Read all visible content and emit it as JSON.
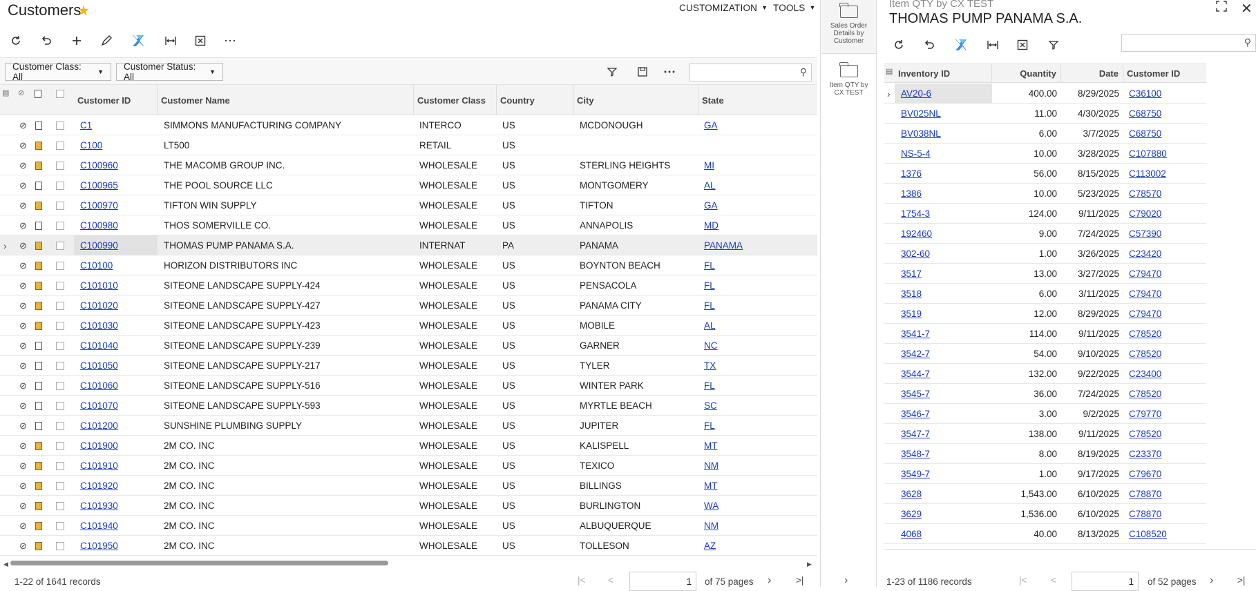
{
  "page": {
    "title": "Customers"
  },
  "menu": {
    "customization": "CUSTOMIZATION",
    "tools": "TOOLS"
  },
  "toolbar_icons": [
    "refresh-icon",
    "undo-icon",
    "add-icon",
    "edit-icon",
    "puzzle-icon",
    "fit-width-icon",
    "export-excel-icon",
    "more-icon"
  ],
  "filters": {
    "customer_class": "Customer Class: All",
    "customer_status": "Customer Status: All"
  },
  "grid": {
    "columns": [
      "Customer ID",
      "Customer Name",
      "Customer Class",
      "Country",
      "City",
      "State"
    ],
    "rows": [
      {
        "id": "C1",
        "name": "SIMMONS MANUFACTURING COMPANY",
        "cls": "INTERCO",
        "country": "US",
        "city": "MCDONOUGH",
        "state": "GA",
        "note": false
      },
      {
        "id": "C100",
        "name": "LT500",
        "cls": "RETAIL",
        "country": "US",
        "city": "",
        "state": "",
        "note": true
      },
      {
        "id": "C100960",
        "name": "THE MACOMB GROUP INC.",
        "cls": "WHOLESALE",
        "country": "US",
        "city": "STERLING HEIGHTS",
        "state": "MI",
        "note": true
      },
      {
        "id": "C100965",
        "name": "THE POOL SOURCE LLC",
        "cls": "WHOLESALE",
        "country": "US",
        "city": "MONTGOMERY",
        "state": "AL",
        "note": false
      },
      {
        "id": "C100970",
        "name": "TIFTON WIN SUPPLY",
        "cls": "WHOLESALE",
        "country": "US",
        "city": "TIFTON",
        "state": "GA",
        "note": true
      },
      {
        "id": "C100980",
        "name": "THOS SOMERVILLE CO.",
        "cls": "WHOLESALE",
        "country": "US",
        "city": "ANNAPOLIS",
        "state": "MD",
        "note": false
      },
      {
        "id": "C100990",
        "name": "THOMAS PUMP PANAMA S.A.",
        "cls": "INTERNAT",
        "country": "PA",
        "city": "PANAMA",
        "state": "PANAMA",
        "note": true,
        "selected": true
      },
      {
        "id": "C10100",
        "name": "HORIZON DISTRIBUTORS INC",
        "cls": "WHOLESALE",
        "country": "US",
        "city": "BOYNTON BEACH",
        "state": "FL",
        "note": true
      },
      {
        "id": "C101010",
        "name": "SITEONE LANDSCAPE SUPPLY-424",
        "cls": "WHOLESALE",
        "country": "US",
        "city": "PENSACOLA",
        "state": "FL",
        "note": true
      },
      {
        "id": "C101020",
        "name": "SITEONE LANDSCAPE SUPPLY-427",
        "cls": "WHOLESALE",
        "country": "US",
        "city": "PANAMA CITY",
        "state": "FL",
        "note": true
      },
      {
        "id": "C101030",
        "name": "SITEONE LANDSCAPE SUPPLY-423",
        "cls": "WHOLESALE",
        "country": "US",
        "city": "MOBILE",
        "state": "AL",
        "note": true
      },
      {
        "id": "C101040",
        "name": "SITEONE LANDSCAPE SUPPLY-239",
        "cls": "WHOLESALE",
        "country": "US",
        "city": "GARNER",
        "state": "NC",
        "note": false
      },
      {
        "id": "C101050",
        "name": "SITEONE LANDSCAPE SUPPLY-217",
        "cls": "WHOLESALE",
        "country": "US",
        "city": "TYLER",
        "state": "TX",
        "note": false
      },
      {
        "id": "C101060",
        "name": "SITEONE LANDSCAPE SUPPLY-516",
        "cls": "WHOLESALE",
        "country": "US",
        "city": "WINTER PARK",
        "state": "FL",
        "note": false
      },
      {
        "id": "C101070",
        "name": "SITEONE LANDSCAPE SUPPLY-593",
        "cls": "WHOLESALE",
        "country": "US",
        "city": "MYRTLE BEACH",
        "state": "SC",
        "note": false
      },
      {
        "id": "C101200",
        "name": "SUNSHINE PLUMBING SUPPLY",
        "cls": "WHOLESALE",
        "country": "US",
        "city": "JUPITER",
        "state": "FL",
        "note": false
      },
      {
        "id": "C101900",
        "name": "2M CO. INC",
        "cls": "WHOLESALE",
        "country": "US",
        "city": "KALISPELL",
        "state": "MT",
        "note": true
      },
      {
        "id": "C101910",
        "name": "2M CO. INC",
        "cls": "WHOLESALE",
        "country": "US",
        "city": "TEXICO",
        "state": "NM",
        "note": true
      },
      {
        "id": "C101920",
        "name": "2M CO. INC",
        "cls": "WHOLESALE",
        "country": "US",
        "city": "BILLINGS",
        "state": "MT",
        "note": true
      },
      {
        "id": "C101930",
        "name": "2M CO. INC",
        "cls": "WHOLESALE",
        "country": "US",
        "city": "BURLINGTON",
        "state": "WA",
        "note": true
      },
      {
        "id": "C101940",
        "name": "2M CO. INC",
        "cls": "WHOLESALE",
        "country": "US",
        "city": "ALBUQUERQUE",
        "state": "NM",
        "note": true
      },
      {
        "id": "C101950",
        "name": "2M CO. INC",
        "cls": "WHOLESALE",
        "country": "US",
        "city": "TOLLESON",
        "state": "AZ",
        "note": true
      }
    ]
  },
  "pager": {
    "records": "1-22 of 1641 records",
    "page": "1",
    "of_pages": "of 75 pages"
  },
  "side_tabs": {
    "tab1": "Sales Order Details by Customer",
    "tab2": "Item QTY by CX TEST"
  },
  "right_panel": {
    "subtitle": "Item QTY by CX TEST",
    "title": "THOMAS PUMP PANAMA S.A.",
    "columns": [
      "Inventory ID",
      "Quantity",
      "Date",
      "Customer ID"
    ],
    "rows": [
      {
        "inv": "AV20-6",
        "qty": "400.00",
        "date": "8/29/2025",
        "cust": "C36100",
        "selected": true
      },
      {
        "inv": "BV025NL",
        "qty": "11.00",
        "date": "4/30/2025",
        "cust": "C68750"
      },
      {
        "inv": "BV038NL",
        "qty": "6.00",
        "date": "3/7/2025",
        "cust": "C68750"
      },
      {
        "inv": "NS-5-4",
        "qty": "10.00",
        "date": "3/28/2025",
        "cust": "C107880"
      },
      {
        "inv": "1376",
        "qty": "56.00",
        "date": "8/15/2025",
        "cust": "C113002"
      },
      {
        "inv": "1386",
        "qty": "10.00",
        "date": "5/23/2025",
        "cust": "C78570"
      },
      {
        "inv": "1754-3",
        "qty": "124.00",
        "date": "9/11/2025",
        "cust": "C79020"
      },
      {
        "inv": "192460",
        "qty": "9.00",
        "date": "7/24/2025",
        "cust": "C57390"
      },
      {
        "inv": "302-60",
        "qty": "1.00",
        "date": "3/26/2025",
        "cust": "C23420"
      },
      {
        "inv": "3517",
        "qty": "13.00",
        "date": "3/27/2025",
        "cust": "C79470"
      },
      {
        "inv": "3518",
        "qty": "6.00",
        "date": "3/11/2025",
        "cust": "C79470"
      },
      {
        "inv": "3519",
        "qty": "12.00",
        "date": "8/29/2025",
        "cust": "C79470"
      },
      {
        "inv": "3541-7",
        "qty": "114.00",
        "date": "9/11/2025",
        "cust": "C78520"
      },
      {
        "inv": "3542-7",
        "qty": "54.00",
        "date": "9/10/2025",
        "cust": "C78520"
      },
      {
        "inv": "3544-7",
        "qty": "132.00",
        "date": "9/22/2025",
        "cust": "C23400"
      },
      {
        "inv": "3545-7",
        "qty": "36.00",
        "date": "7/24/2025",
        "cust": "C78520"
      },
      {
        "inv": "3546-7",
        "qty": "3.00",
        "date": "9/2/2025",
        "cust": "C79770"
      },
      {
        "inv": "3547-7",
        "qty": "138.00",
        "date": "9/11/2025",
        "cust": "C78520"
      },
      {
        "inv": "3548-7",
        "qty": "8.00",
        "date": "8/19/2025",
        "cust": "C23370"
      },
      {
        "inv": "3549-7",
        "qty": "1.00",
        "date": "9/17/2025",
        "cust": "C79670"
      },
      {
        "inv": "3628",
        "qty": "1,543.00",
        "date": "6/10/2025",
        "cust": "C78870"
      },
      {
        "inv": "3629",
        "qty": "1,536.00",
        "date": "6/10/2025",
        "cust": "C78870"
      },
      {
        "inv": "4068",
        "qty": "40.00",
        "date": "8/13/2025",
        "cust": "C108520"
      }
    ],
    "pager": {
      "records": "1-23 of 1186 records",
      "page": "1",
      "of_pages": "of 52 pages"
    }
  },
  "colors": {
    "link": "#1a3bc1",
    "star": "#f2b705",
    "note": "#e8b53c",
    "selected_row": "#eeeeee"
  }
}
